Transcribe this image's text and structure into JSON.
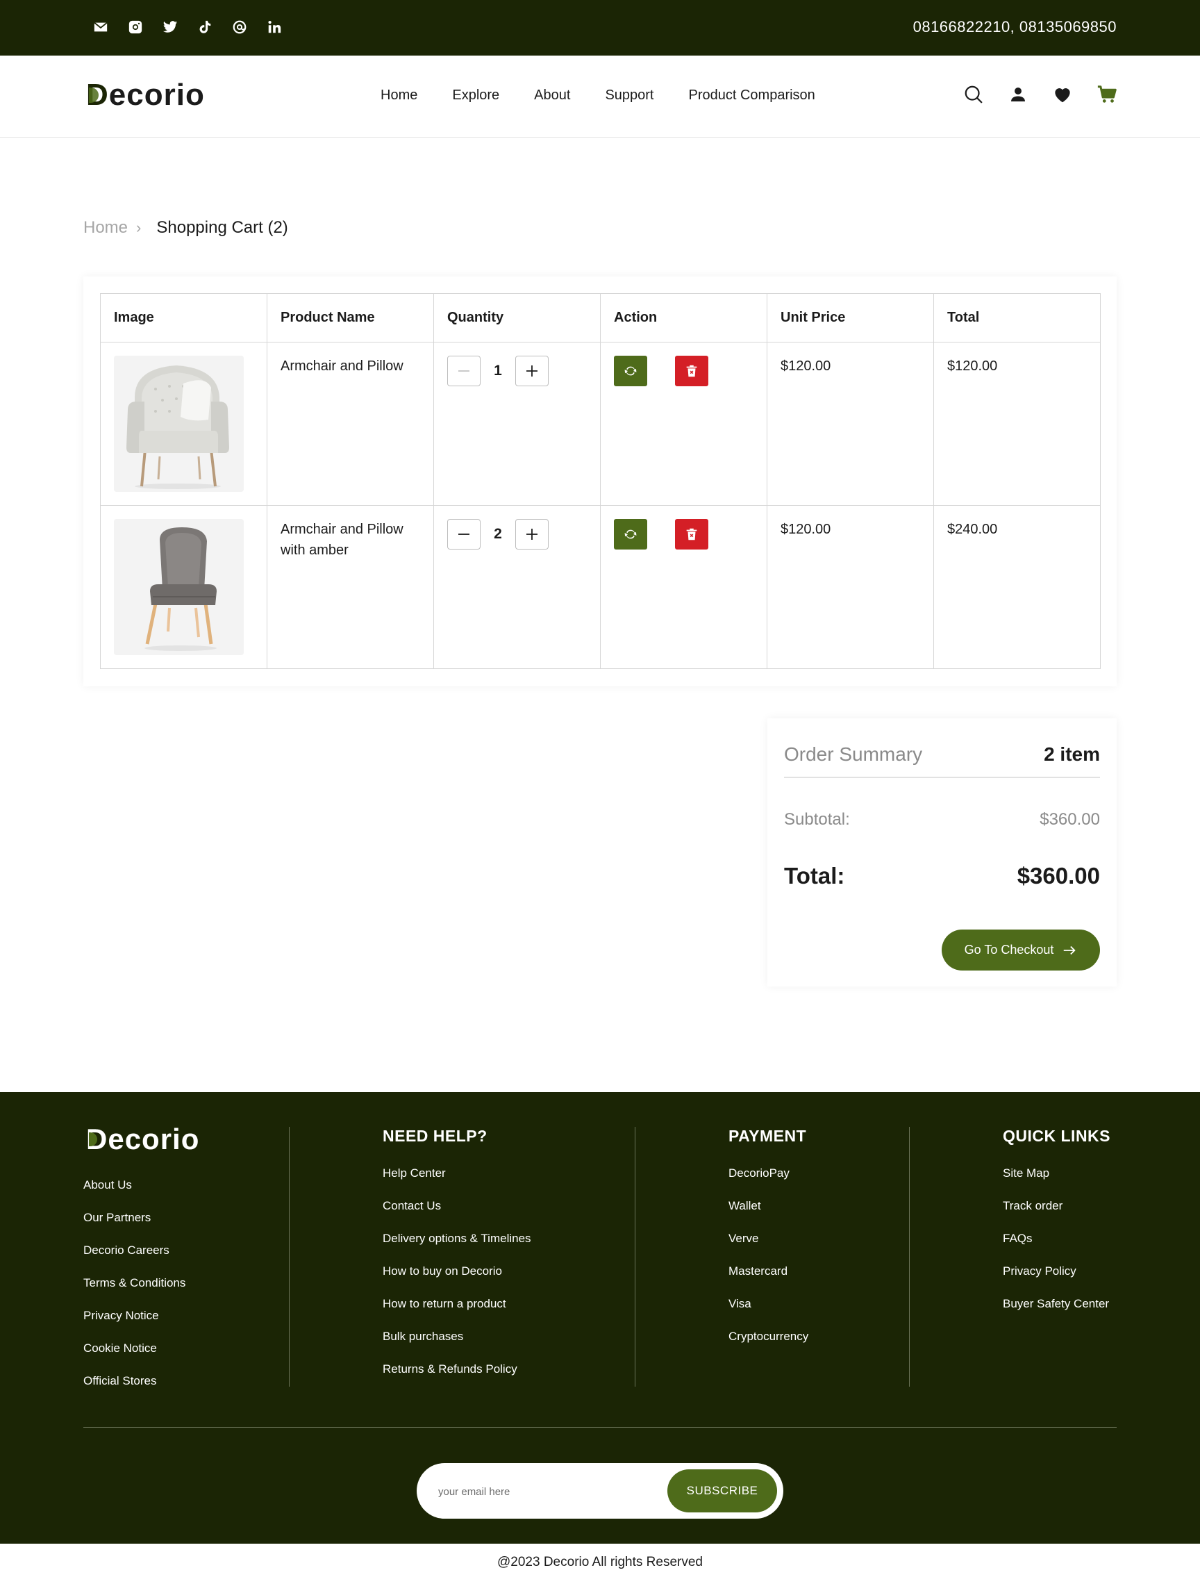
{
  "topbar": {
    "social_icons": [
      "email-icon",
      "instagram-icon",
      "twitter-icon",
      "tiktok-icon",
      "threads-icon",
      "linkedin-icon"
    ],
    "phones": "08166822210, 08135069850"
  },
  "header": {
    "logo": {
      "first": "D",
      "rest": "ecorio"
    },
    "nav": [
      "Home",
      "Explore",
      "About",
      "Support",
      "Product Comparison"
    ],
    "icons": [
      "search-icon",
      "user-icon",
      "heart-icon",
      "cart-icon"
    ]
  },
  "breadcrumb": {
    "home": "Home",
    "separator": "›",
    "current": "Shopping Cart (2)"
  },
  "cart": {
    "columns": [
      "Image",
      "Product Name",
      "Quantity",
      "Action",
      "Unit Price",
      "Total"
    ],
    "rows": [
      {
        "name": "Armchair and Pillow",
        "quantity": "1",
        "unit_price": "$120.00",
        "total": "$120.00",
        "image": "armchair-image"
      },
      {
        "name": "Armchair and Pillow with amber",
        "quantity": "2",
        "unit_price": "$120.00",
        "total": "$240.00",
        "image": "chair-image"
      }
    ]
  },
  "summary": {
    "title": "Order Summary",
    "count": "2 item",
    "subtotal_label": "Subtotal:",
    "subtotal_value": "$360.00",
    "total_label": "Total:",
    "total_value": "$360.00",
    "checkout_label": "Go To Checkout"
  },
  "footer": {
    "logo": {
      "first": "D",
      "rest": "ecorio"
    },
    "col1": [
      "About Us",
      "Our Partners",
      "Decorio Careers",
      "Terms & Conditions",
      "Privacy Notice",
      "Cookie Notice",
      "Official Stores"
    ],
    "col2": {
      "title": "NEED HELP?",
      "items": [
        "Help Center",
        "Contact Us",
        "Delivery options & Timelines",
        "How to buy on Decorio",
        "How to return a product",
        "Bulk purchases",
        "Returns & Refunds Policy"
      ]
    },
    "col3": {
      "title": "PAYMENT",
      "items": [
        "DecorioPay",
        "Wallet",
        "Verve",
        "Mastercard",
        "Visa",
        "Cryptocurrency"
      ]
    },
    "col4": {
      "title": "QUICK LINKS",
      "items": [
        "Site Map",
        "Track order",
        "FAQs",
        "Privacy Policy",
        "Buyer Safety Center"
      ]
    },
    "newsletter": {
      "placeholder": "your email here",
      "button": "SUBSCRIBE"
    }
  },
  "copyright": "@2023 Decorio All rights Reserved",
  "colors": {
    "dark_green": "#1b2505",
    "accent_green": "#4e6b1a",
    "delete_red": "#d41f26"
  }
}
